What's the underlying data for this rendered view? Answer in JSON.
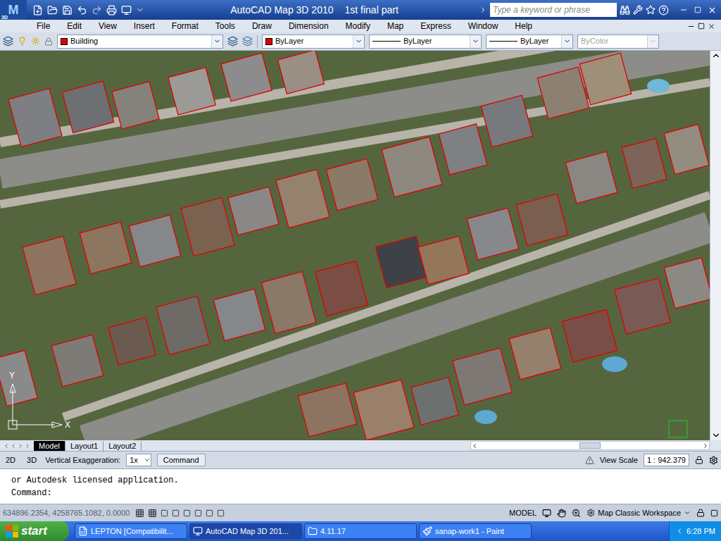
{
  "window": {
    "title": "AutoCAD Map 3D 2010",
    "document": "1st final part"
  },
  "app_logo": {
    "letter": "M",
    "badge": "3D"
  },
  "search": {
    "placeholder": "Type a keyword or phrase"
  },
  "menu": [
    "File",
    "Edit",
    "View",
    "Insert",
    "Format",
    "Tools",
    "Draw",
    "Dimension",
    "Modify",
    "Map",
    "Express",
    "Window",
    "Help"
  ],
  "properties": {
    "layer": "Building",
    "layer_color": "#e00000",
    "color": "ByLayer",
    "color_swatch": "#e00000",
    "linetype": "ByLayer",
    "lineweight": "ByLayer",
    "plotstyle": {
      "label": "ByColor",
      "disabled": true
    }
  },
  "ucs": {
    "x": "X",
    "y": "Y"
  },
  "layout_tabs": [
    {
      "label": "Model",
      "selected": true
    },
    {
      "label": "Layout1",
      "selected": false
    },
    {
      "label": "Layout2",
      "selected": false
    }
  ],
  "map_status": {
    "modes": [
      {
        "label": "2D"
      },
      {
        "label": "3D"
      }
    ],
    "exaggeration_label": "Vertical Exaggeration:",
    "exaggeration": "1x",
    "command_button": "Command",
    "view_scale_label": "View Scale",
    "view_scale": "1 : 942.379"
  },
  "command_line": {
    "history": [
      "or Autodesk licensed application."
    ],
    "prompt": "Command:"
  },
  "status_bar": {
    "coordinates": "634896.2354, 4258765.1082, 0.0000",
    "space": "MODEL",
    "workspace": "Map Classic Workspace"
  },
  "taskbar": {
    "start": "start",
    "tasks": [
      {
        "label": "LEPTON  [Compatibilit...",
        "selected": false
      },
      {
        "label": "AutoCAD Map 3D 201...",
        "selected": true
      },
      {
        "label": "4.11.17",
        "selected": false
      },
      {
        "label": "sanap-work1 - Paint",
        "selected": false
      }
    ],
    "clock": "6:28 PM"
  }
}
